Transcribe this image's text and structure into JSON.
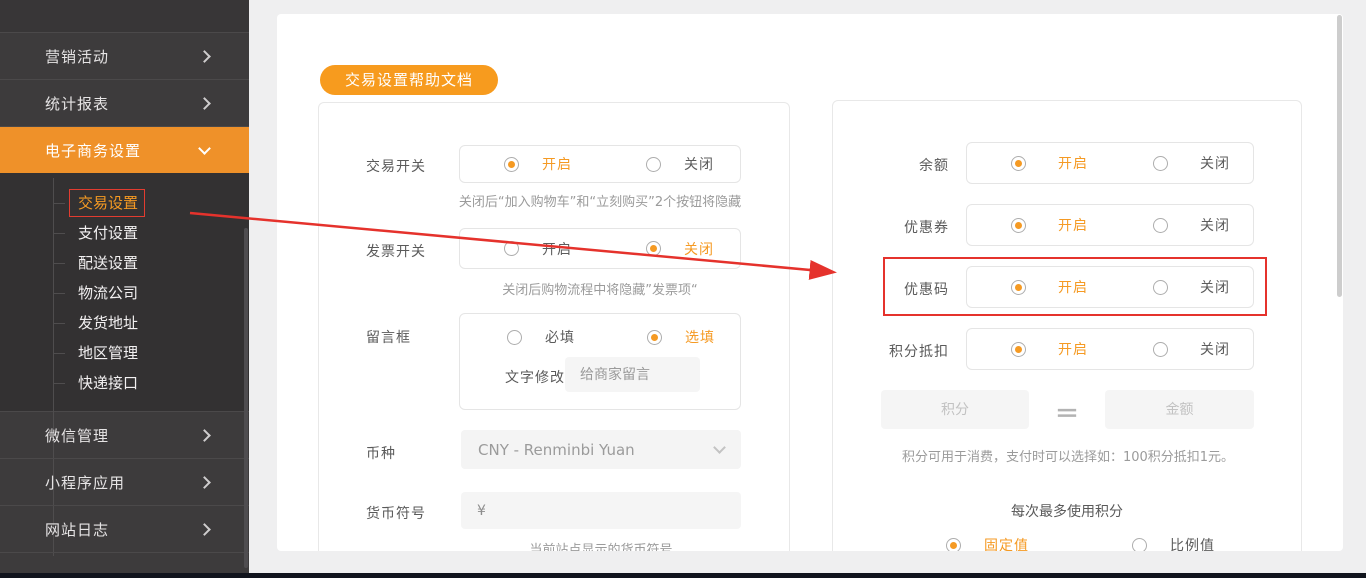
{
  "colors": {
    "accent_orange": "#f59a23",
    "sidebar_active_orange": "#ef9129",
    "button_orange": "#f79b1e",
    "annotation_red": "#e5322c",
    "sidebar_bg": "#3d3b3c",
    "page_bg": "#efeff0"
  },
  "sidebar": {
    "top_items": [
      {
        "label": "营销活动"
      },
      {
        "label": "统计报表"
      }
    ],
    "active_item_label": "电子商务设置",
    "sub_items": [
      {
        "label": "交易设置"
      },
      {
        "label": "支付设置"
      },
      {
        "label": "配送设置"
      },
      {
        "label": "物流公司"
      },
      {
        "label": "发货地址"
      },
      {
        "label": "地区管理"
      },
      {
        "label": "快递接口"
      }
    ],
    "bottom_items": [
      {
        "label": "微信管理"
      },
      {
        "label": "小程序应用"
      },
      {
        "label": "网站日志"
      }
    ]
  },
  "main": {
    "help_button_label": "交易设置帮助文档",
    "left_card": {
      "transaction_switch": {
        "label": "交易开关",
        "on": "开启",
        "off": "关闭",
        "selected": "on",
        "helper": "关闭后“加入购物车”和“立刻购买”2个按钮将隐藏"
      },
      "invoice_switch": {
        "label": "发票开关",
        "on": "开启",
        "off": "关闭",
        "selected": "off",
        "helper": "关闭后购物流程中将隐藏”发票项“"
      },
      "message_box": {
        "label": "留言框",
        "required": "必填",
        "optional": "选填",
        "selected": "optional",
        "modify_label": "文字修改",
        "input_placeholder": "给商家留言"
      },
      "currency": {
        "label": "币种",
        "value": "CNY - Renminbi Yuan"
      },
      "currency_symbol": {
        "label": "货币符号",
        "value": "¥",
        "helper": "当前站点显示的货币符号"
      }
    },
    "right_card": {
      "balance": {
        "label": "余额",
        "on": "开启",
        "off": "关闭",
        "selected": "on"
      },
      "coupon": {
        "label": "优惠券",
        "on": "开启",
        "off": "关闭",
        "selected": "on"
      },
      "coupon_code": {
        "label": "优惠码",
        "on": "开启",
        "off": "关闭",
        "selected": "on"
      },
      "points_deduction": {
        "label": "积分抵扣",
        "on": "开启",
        "off": "关闭",
        "selected": "on"
      },
      "points_placeholder": "积分",
      "amount_placeholder": "金额",
      "equals_sign": "＝",
      "points_helper": "积分可用于消费，支付时可以选择如：100积分抵扣1元。",
      "max_points_label": "每次最多使用积分",
      "fixed_value_label": "固定值",
      "ratio_value_label": "比例值"
    }
  }
}
